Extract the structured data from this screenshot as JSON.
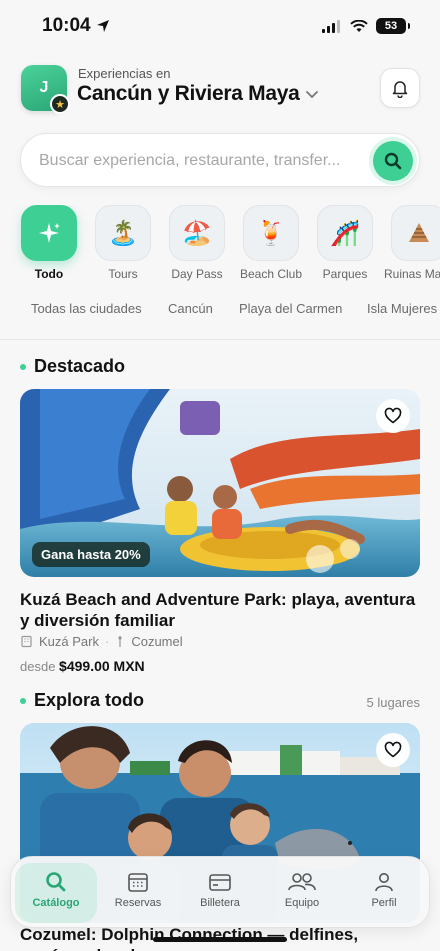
{
  "status": {
    "time": "10:04",
    "battery": "53"
  },
  "header": {
    "avatar_initial": "J",
    "subtitle": "Experiencias en",
    "location": "Cancún y Riviera Maya"
  },
  "search": {
    "placeholder": "Buscar experiencia, restaurante, transfer..."
  },
  "categories": [
    {
      "label": "Todo",
      "icon": "sparkles-icon"
    },
    {
      "label": "Tours",
      "icon": "island-icon"
    },
    {
      "label": "Day Pass",
      "icon": "beach-umbrella-icon"
    },
    {
      "label": "Beach Club",
      "icon": "cocktail-icon"
    },
    {
      "label": "Parques",
      "icon": "roller-coaster-icon"
    },
    {
      "label": "Ruinas Mayas",
      "icon": "pyramid-icon"
    }
  ],
  "cities": [
    "Todas las ciudades",
    "Cancún",
    "Playa del Carmen",
    "Isla Mujeres"
  ],
  "featured": {
    "section_title": "Destacado",
    "badge": "Gana hasta 20%",
    "title": "Kuzá Beach and Adventure Park: playa, aventura y diversión familiar",
    "provider": "Kuzá Park",
    "city": "Cozumel",
    "price_prefix": "desde",
    "price": "$499.00 MXN"
  },
  "explore": {
    "section_title": "Explora todo",
    "count": "5 lugares",
    "title": "Cozumel: Dolphin Connection — delfines, esnórquel y playa"
  },
  "tabs": [
    {
      "label": "Catálogo",
      "icon": "search-icon"
    },
    {
      "label": "Reservas",
      "icon": "calendar-icon"
    },
    {
      "label": "Billetera",
      "icon": "wallet-icon"
    },
    {
      "label": "Equipo",
      "icon": "team-icon"
    },
    {
      "label": "Perfil",
      "icon": "user-icon"
    }
  ],
  "colors": {
    "accent": "#3ecf95",
    "accent_dark": "#2aa676",
    "background": "#f7f7f8"
  }
}
